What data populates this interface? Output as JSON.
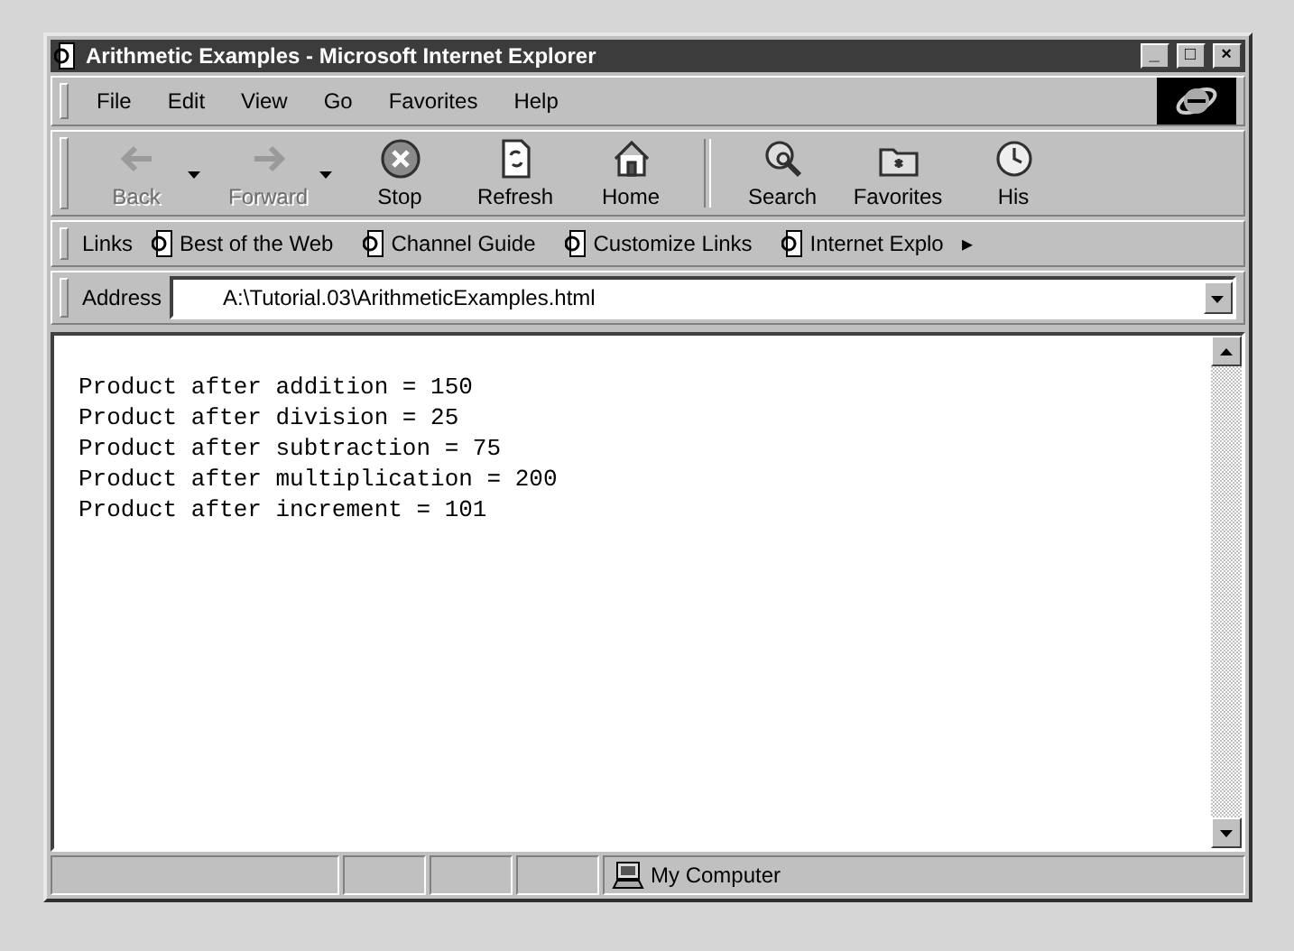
{
  "window": {
    "title": "Arithmetic Examples - Microsoft Internet Explorer",
    "controls": [
      "_",
      "□",
      "×"
    ]
  },
  "menu": [
    "File",
    "Edit",
    "View",
    "Go",
    "Favorites",
    "Help"
  ],
  "toolbar": [
    {
      "label": "Back",
      "kind": "back",
      "disabled": true,
      "dropdown": true
    },
    {
      "label": "Forward",
      "kind": "forward",
      "disabled": true,
      "dropdown": true
    },
    {
      "label": "Stop",
      "kind": "stop",
      "disabled": false,
      "dropdown": false
    },
    {
      "label": "Refresh",
      "kind": "refresh",
      "disabled": false,
      "dropdown": false
    },
    {
      "label": "Home",
      "kind": "home",
      "disabled": false,
      "dropdown": false
    },
    {
      "label": "Search",
      "kind": "search",
      "disabled": false,
      "dropdown": false
    },
    {
      "label": "Favorites",
      "kind": "favorites",
      "disabled": false,
      "dropdown": false
    },
    {
      "label": "His",
      "kind": "history",
      "disabled": false,
      "dropdown": false
    }
  ],
  "links": {
    "label": "Links",
    "items": [
      "Best of the Web",
      "Channel Guide",
      "Customize Links",
      "Internet Explo"
    ],
    "more": "▸"
  },
  "address": {
    "label": "Address",
    "value": "A:\\Tutorial.03\\ArithmeticExamples.html"
  },
  "content": {
    "lines": [
      "Product after addition = 150",
      "Product after division = 25",
      "Product after subtraction = 75",
      "Product after multiplication = 200",
      "Product after increment = 101"
    ]
  },
  "status_bar": {
    "zone": "My Computer"
  }
}
